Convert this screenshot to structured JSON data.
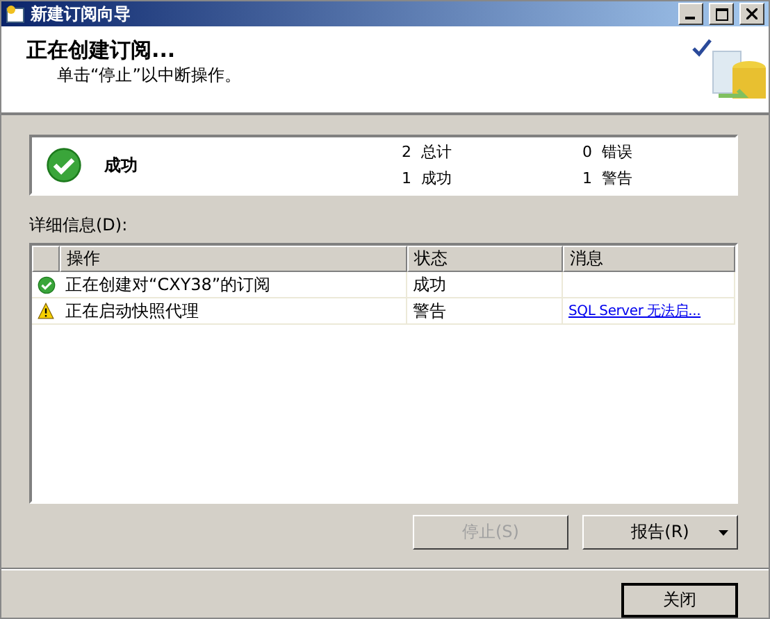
{
  "window": {
    "title": "新建订阅向导"
  },
  "header": {
    "title": "正在创建订阅...",
    "subtitle": "单击“停止”以中断操作。"
  },
  "summary": {
    "kind": "success",
    "status": "成功",
    "stats": [
      {
        "count": "2",
        "label": "总计"
      },
      {
        "count": "0",
        "label": "错误"
      },
      {
        "count": "1",
        "label": "成功"
      },
      {
        "count": "1",
        "label": "警告"
      }
    ]
  },
  "details_label": "详细信息(D):",
  "table": {
    "columns": [
      "操作",
      "状态",
      "消息"
    ],
    "rows": [
      {
        "kind": "success",
        "action": "正在创建对“CXY38”的订阅",
        "status": "成功"
      },
      {
        "kind": "warning",
        "action": "正在启动快照代理",
        "status": "警告",
        "message": "SQL Server 无法启..."
      }
    ]
  },
  "buttons": [
    {
      "label": "停止(S)",
      "disabled": true,
      "dropdown": false
    },
    {
      "label": "报告(R)",
      "disabled": false,
      "dropdown": true
    }
  ],
  "close_button": {
    "label": "关闭"
  }
}
